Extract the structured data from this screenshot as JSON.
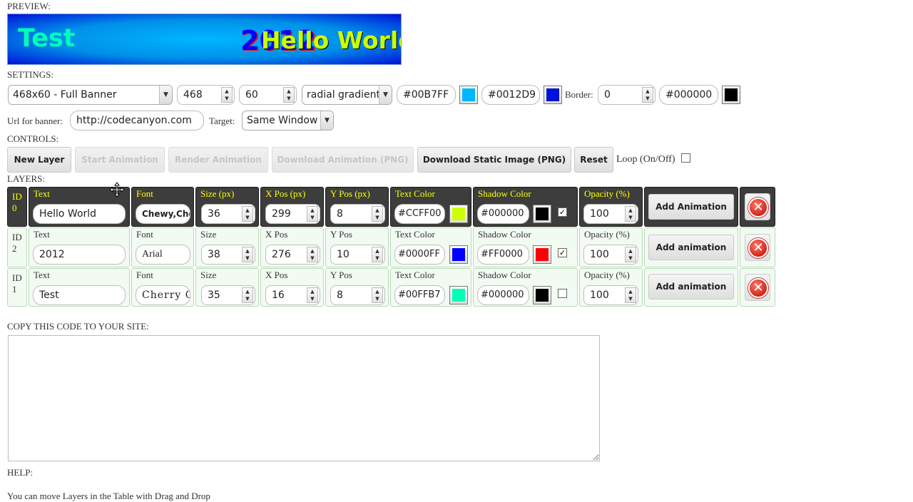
{
  "sections": {
    "preview": "PREVIEW:",
    "settings": "SETTINGS:",
    "controls": "CONTROLS:",
    "layers": "LAYERS:",
    "copy": "COPY THIS CODE TO YOUR SITE:",
    "help": "HELP:"
  },
  "preview": {
    "layer_texts": [
      "Test",
      "2012",
      "Hello World"
    ]
  },
  "settings": {
    "size_preset": "468x60 - Full Banner",
    "width": "468",
    "height": "60",
    "background_type": "radial gradient",
    "color1": "#00B7FF",
    "color2": "#0012D9",
    "border_label": "Border:",
    "border_width": "0",
    "border_color": "#000000",
    "url_label": "Url for banner:",
    "url_value": "http://codecanyon.com",
    "target_label": "Target:",
    "target_value": "Same Window"
  },
  "controls": {
    "new_layer": "New Layer",
    "start_animation": "Start Animation",
    "render_animation": "Render Animation",
    "download_animation": "Download Animation (PNG)",
    "download_static": "Download Static Image (PNG)",
    "reset": "Reset",
    "loop_label": "Loop (On/Off)"
  },
  "layers": {
    "headers": {
      "id": [
        "ID",
        "0"
      ],
      "text": "Text",
      "font": "Font",
      "size": "Size (px)",
      "xpos": "X Pos (px)",
      "ypos": "Y Pos (px)",
      "text_color": "Text Color",
      "shadow_color": "Shadow Color",
      "opacity": "Opacity (%)",
      "add_animation": "Add Animation"
    },
    "rows": [
      {
        "id": [
          "ID",
          "0"
        ],
        "text_label": "Text",
        "text": "Hello World",
        "font_label": "Font",
        "font": "Chewy,Chewy",
        "size_label": "Size (px)",
        "size": "36",
        "xpos_label": "X Pos (px)",
        "xpos": "299",
        "ypos_label": "Y Pos (px)",
        "ypos": "8",
        "text_color_label": "Text Color",
        "text_color": "#CCFF00",
        "shadow_color_label": "Shadow Color",
        "shadow_color": "#000000",
        "shadow_on": "✓",
        "opacity_label": "Opacity (%)",
        "opacity": "100",
        "add_animation": "Add Animation"
      },
      {
        "id": [
          "ID",
          "2"
        ],
        "text_label": "Text",
        "text": "2012",
        "font_label": "Font",
        "font": "Arial",
        "size_label": "Size",
        "size": "38",
        "xpos_label": "X Pos",
        "xpos": "276",
        "ypos_label": "Y Pos",
        "ypos": "10",
        "text_color_label": "Text Color",
        "text_color": "#0000FF",
        "shadow_color_label": "Shadow Color",
        "shadow_color": "#FF0000",
        "shadow_on": "✓",
        "opacity_label": "Opacity (%)",
        "opacity": "100",
        "add_animation": "Add animation"
      },
      {
        "id": [
          "ID",
          "1"
        ],
        "text_label": "Text",
        "text": "Test",
        "font_label": "Font",
        "font": "Cherry Cream",
        "size_label": "Size",
        "size": "35",
        "xpos_label": "X Pos",
        "xpos": "16",
        "ypos_label": "Y Pos",
        "ypos": "8",
        "text_color_label": "Text Color",
        "text_color": "#00FFB7",
        "shadow_color_label": "Shadow Color",
        "shadow_color": "#000000",
        "shadow_on": "",
        "opacity_label": "Opacity (%)",
        "opacity": "100",
        "add_animation": "Add animation"
      }
    ]
  },
  "help": {
    "line1": "You can move Layers in the Table with Drag and Drop"
  },
  "icons": {
    "delete": "close-circle-icon",
    "move_cursor": "move-cursor-icon"
  }
}
